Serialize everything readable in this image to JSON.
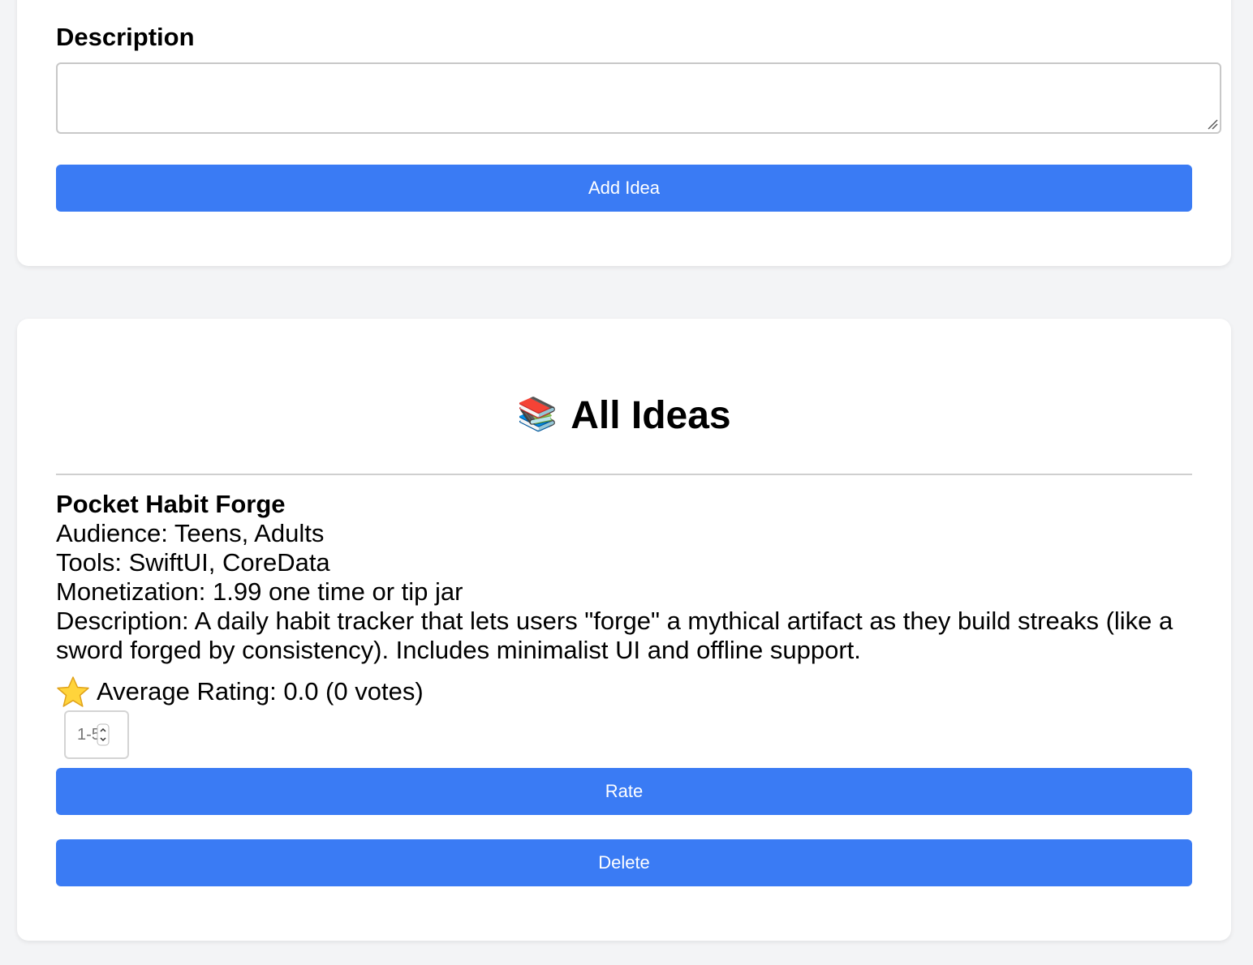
{
  "form": {
    "description_label": "Description",
    "description_value": "",
    "add_button_label": "Add Idea"
  },
  "ideas_section": {
    "icon": "books-icon",
    "title": "All Ideas",
    "ideas": [
      {
        "name": "Pocket Habit Forge",
        "audience": "Audience: Teens, Adults",
        "tools": "Tools: SwiftUI, CoreData",
        "monetization": "Monetization: 1.99 one time or tip jar",
        "description": "Description: A daily habit tracker that lets users \"forge\" a mythical artifact as they build streaks (like a sword forged by consistency). Includes minimalist UI and offline support.",
        "rating_icon": "star-icon",
        "average_rating": "Average Rating: 0.0 (0 votes)",
        "rating_placeholder": "1-5",
        "rate_button_label": "Rate",
        "delete_button_label": "Delete"
      }
    ]
  },
  "colors": {
    "page_background": "#f3f4f6",
    "card_background": "#ffffff",
    "button_primary": "#3a7bf4",
    "button_text": "#ffffff"
  }
}
